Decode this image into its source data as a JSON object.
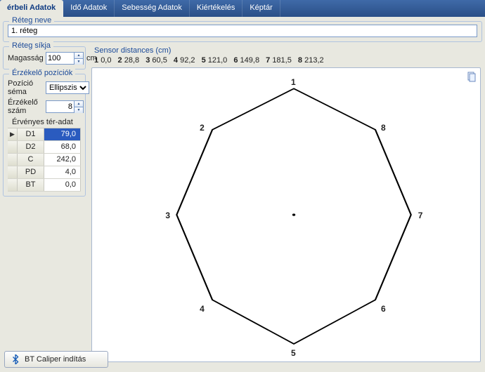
{
  "tabs": {
    "t0": "érbeli Adatok",
    "t1": "Idő Adatok",
    "t2": "Sebesség Adatok",
    "t3": "Kiértékelés",
    "t4": "Képtár"
  },
  "layer": {
    "legend": "Réteg neve",
    "value": "1. réteg"
  },
  "plane": {
    "legend": "Réteg síkja",
    "height_label": "Magasság",
    "height_value": "100",
    "unit": "cm"
  },
  "positions": {
    "legend": "Érzékelő pozíciók",
    "scheme_label": "Pozíció séma",
    "scheme_value": "Ellipszis",
    "count_label": "Érzékelő szám",
    "count_value": "8",
    "table_header": "Érvényes tér-adat",
    "rows": [
      {
        "k": "D1",
        "v": "79,0"
      },
      {
        "k": "D2",
        "v": "68,0"
      },
      {
        "k": "C",
        "v": "242,0"
      },
      {
        "k": "PD",
        "v": "4,0"
      },
      {
        "k": "BT",
        "v": "0,0"
      }
    ]
  },
  "distances": {
    "title": "Sensor distances (cm)",
    "items": [
      {
        "n": "1",
        "v": "0,0"
      },
      {
        "n": "2",
        "v": "28,8"
      },
      {
        "n": "3",
        "v": "60,5"
      },
      {
        "n": "4",
        "v": "92,2"
      },
      {
        "n": "5",
        "v": "121,0"
      },
      {
        "n": "6",
        "v": "149,8"
      },
      {
        "n": "7",
        "v": "181,5"
      },
      {
        "n": "8",
        "v": "213,2"
      }
    ]
  },
  "button": {
    "label": "BT Caliper indítás"
  },
  "chart_data": {
    "type": "scatter",
    "title": "",
    "nodes": [
      {
        "id": "1",
        "x": 0.52,
        "y": 0.07
      },
      {
        "id": "2",
        "x": 0.31,
        "y": 0.21
      },
      {
        "id": "3",
        "x": 0.218,
        "y": 0.5
      },
      {
        "id": "4",
        "x": 0.31,
        "y": 0.79
      },
      {
        "id": "5",
        "x": 0.52,
        "y": 0.94
      },
      {
        "id": "6",
        "x": 0.73,
        "y": 0.79
      },
      {
        "id": "7",
        "x": 0.822,
        "y": 0.5
      },
      {
        "id": "8",
        "x": 0.73,
        "y": 0.21
      }
    ],
    "center": {
      "x": 0.52,
      "y": 0.5
    }
  }
}
